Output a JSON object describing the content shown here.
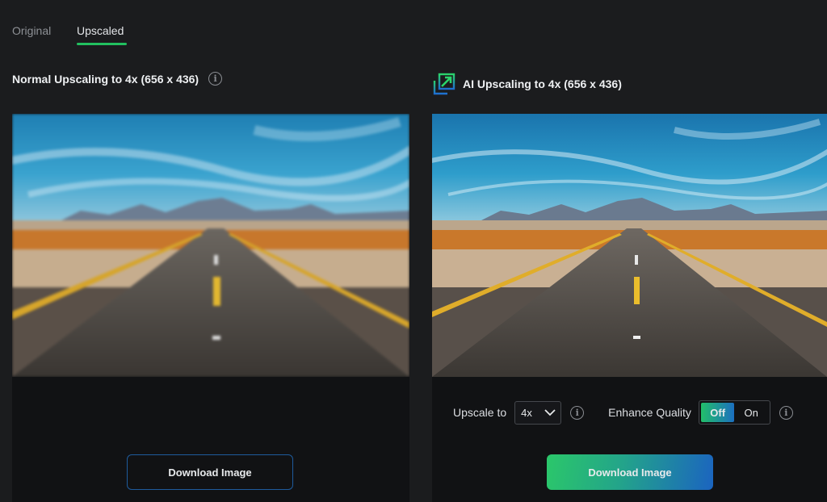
{
  "tabs": [
    {
      "label": "Original",
      "active": false
    },
    {
      "label": "Upscaled",
      "active": true
    }
  ],
  "left_panel": {
    "title": "Normal Upscaling to 4x (656 x 436)",
    "info_icon": "info-icon",
    "image_alt": "Desert highway (normal upscale, blurry)",
    "download_label": "Download Image"
  },
  "right_panel": {
    "icon": "ai-upscale-icon",
    "title": "AI Upscaling to 4x (656 x 436)",
    "image_alt": "Desert highway (AI upscale, sharp)",
    "controls": {
      "upscale_label": "Upscale to",
      "upscale_value": "4x",
      "enhance_label": "Enhance Quality",
      "toggle_off": "Off",
      "toggle_on": "On",
      "toggle_selected": "Off",
      "info_glyph": "i"
    },
    "download_label": "Download Image"
  },
  "colors": {
    "accent_green": "#22c05f",
    "accent_blue": "#1b64c0",
    "background": "#1b1c1e",
    "panel": "#111214"
  }
}
